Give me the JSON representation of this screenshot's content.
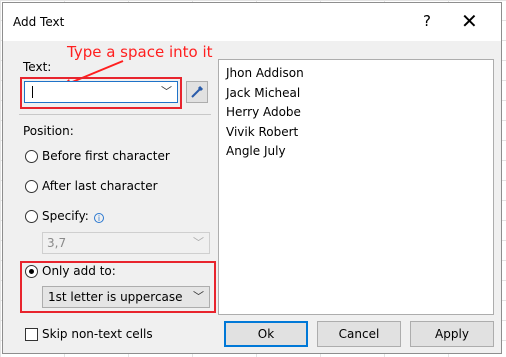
{
  "dialog": {
    "title": "Add Text",
    "help_glyph": "?",
    "close_glyph": "✕"
  },
  "annotation": {
    "text": "Type a space into it",
    "color": "#ff1f1f"
  },
  "text_field": {
    "label": "Text:",
    "value": "",
    "picker_icon": "eyedropper-icon"
  },
  "position": {
    "label": "Position:",
    "options": [
      {
        "label": "Before first character",
        "checked": false
      },
      {
        "label": "After last character",
        "checked": false
      },
      {
        "label": "Specify:",
        "checked": false
      },
      {
        "label": "Only add to:",
        "checked": true
      }
    ],
    "specify_value": "3,7",
    "only_add_to_value": "1st letter is uppercase"
  },
  "skip_non_text": {
    "label": "Skip non-text cells",
    "checked": false
  },
  "preview": {
    "items": [
      "Jhon Addison",
      "Jack Micheal",
      "Herry Adobe",
      "Vivik Robert",
      "Angle July"
    ]
  },
  "buttons": {
    "ok": "Ok",
    "cancel": "Cancel",
    "apply": "Apply"
  },
  "colors": {
    "highlight": "#e8242d",
    "accent": "#0078d7"
  }
}
